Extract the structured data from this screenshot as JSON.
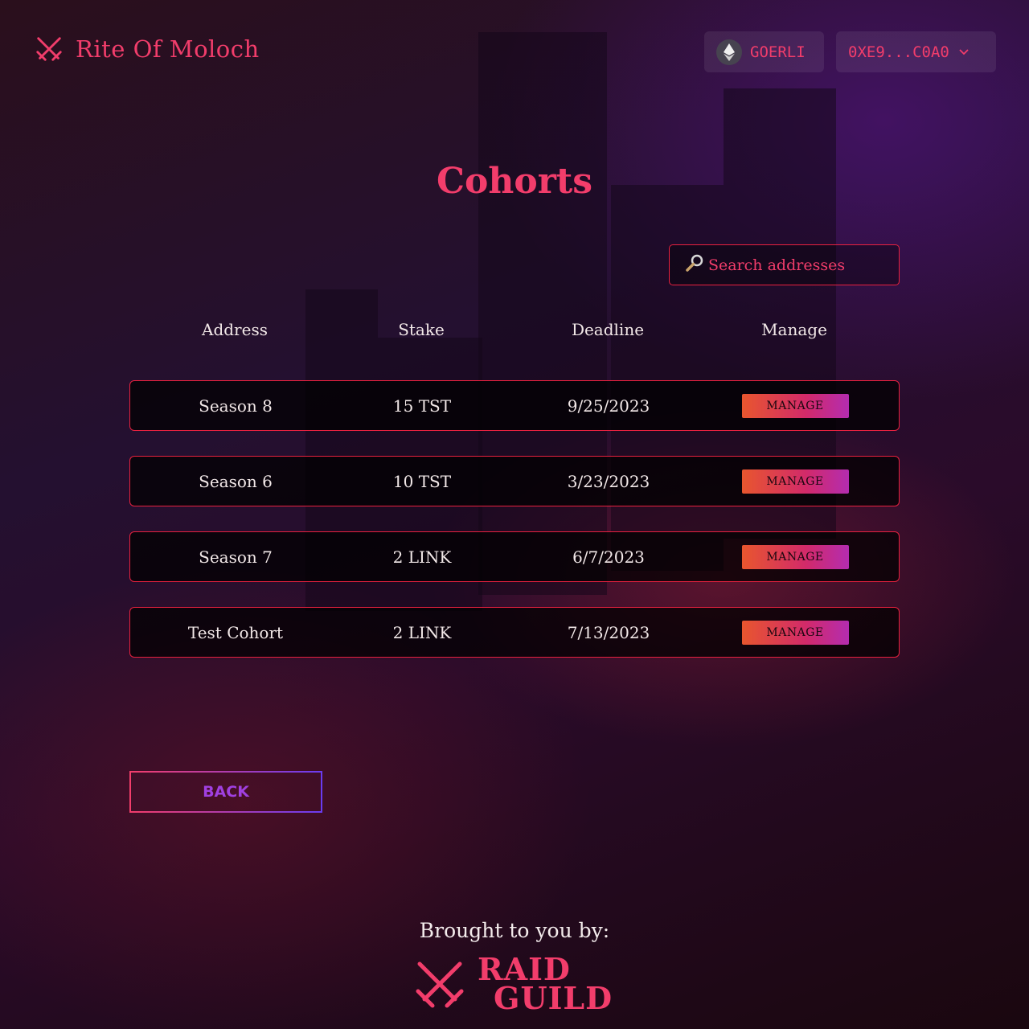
{
  "header": {
    "app_title": "Rite Of Moloch",
    "logo_icon": "crossed-swords-icon",
    "network_label": "GOERLI",
    "network_icon": "ethereum-icon",
    "account_label": "0XE9...C0A0",
    "account_chevron": "chevron-down-icon"
  },
  "page": {
    "title": "Cohorts"
  },
  "search": {
    "placeholder": "Search addresses",
    "icon": "search-icon"
  },
  "table": {
    "headers": [
      "Address",
      "Stake",
      "Deadline",
      "Manage"
    ],
    "rows": [
      {
        "address": "Season 8",
        "stake": "15  TST",
        "deadline": "9/25/2023",
        "manage": "MANAGE"
      },
      {
        "address": "Season 6",
        "stake": "10  TST",
        "deadline": "3/23/2023",
        "manage": "MANAGE"
      },
      {
        "address": "Season 7",
        "stake": "2  LINK",
        "deadline": "6/7/2023",
        "manage": "MANAGE"
      },
      {
        "address": "Test Cohort",
        "stake": "2  LINK",
        "deadline": "7/13/2023",
        "manage": "MANAGE"
      }
    ]
  },
  "back_label": "BACK",
  "footer": {
    "brought_by": "Brought to you by:",
    "brand_line1": "RAID",
    "brand_line2": "GUILD"
  },
  "colors": {
    "accent": "#f23d6b",
    "border": "#e8213f",
    "button_gradient_start": "#e8562e",
    "button_gradient_end": "#b42cb0",
    "back_text": "#a040e0"
  }
}
